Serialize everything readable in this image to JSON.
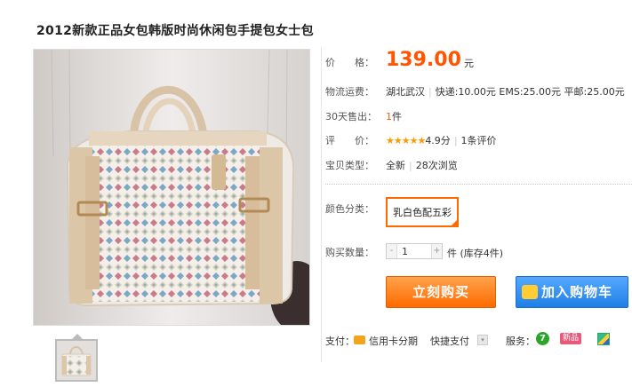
{
  "title": "2012新款正品女包韩版时尚休闲包手提包女士包",
  "product": {
    "image_icon": "handbag-photo",
    "thumb_icon": "handbag-thumbnail"
  },
  "price": {
    "label": "价　　格：",
    "value": "139.00",
    "unit": "元",
    "color": "#ff5500"
  },
  "shipping": {
    "label": "物流运费：",
    "origin": "湖北武汉",
    "detail": "快递:10.00元  EMS:25.00元  平邮:25.00元"
  },
  "sales": {
    "label": "30天售出：",
    "count": "1",
    "unit": "件"
  },
  "review": {
    "label": "评　　价：",
    "stars": "★★★★★",
    "score": "4.9分",
    "count": "1条评价"
  },
  "item_type": {
    "label": "宝贝类型：",
    "condition": "全新",
    "views": "28次浏览"
  },
  "color": {
    "label": "颜色分类：",
    "selected": "乳白色配五彩"
  },
  "quantity": {
    "label": "购买数量：",
    "minus": "-",
    "value": "1",
    "plus": "+",
    "stock": "件 (库存4件)"
  },
  "buttons": {
    "buy_now": "立刻购买",
    "add_to_cart": "加入购物车"
  },
  "payment": {
    "label": "支付：",
    "installment": "信用卡分期",
    "quick_pay": "快捷支付",
    "quick_pay_arrow": "▾"
  },
  "service": {
    "label": "服务：",
    "seven_day": "7",
    "new_badge": "新品"
  },
  "colors": {
    "accent": "#ff5500",
    "buy": "#ff6a00",
    "cart": "#2b8cf0"
  }
}
